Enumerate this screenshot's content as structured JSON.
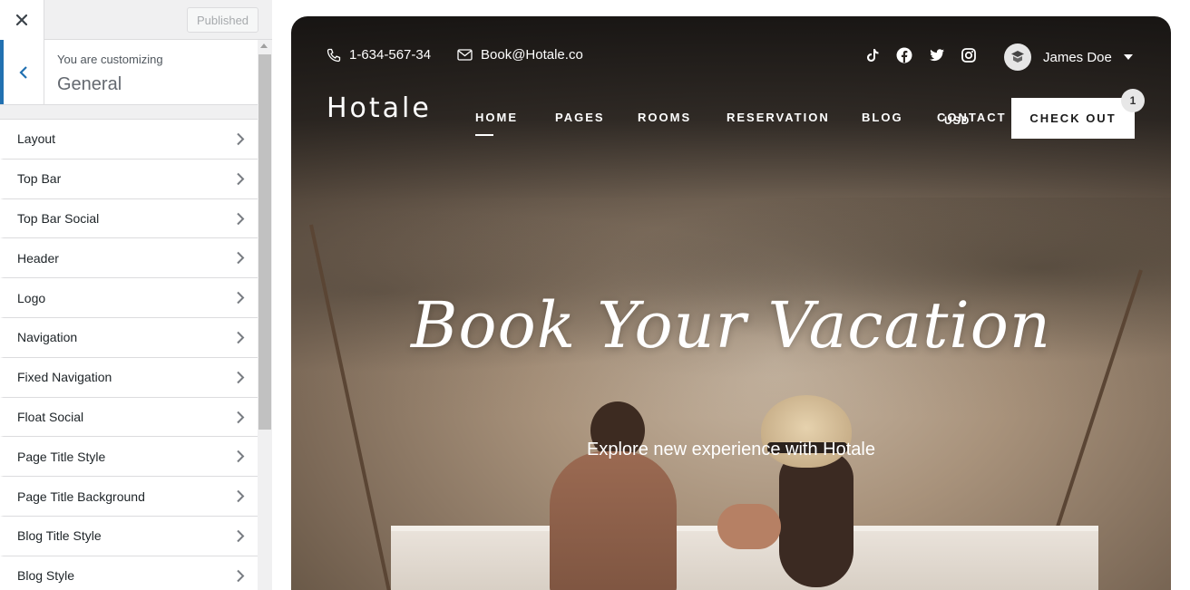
{
  "sidebar": {
    "published_label": "Published",
    "customizing_label": "You are customizing",
    "section_title": "General",
    "items": [
      {
        "label": "Layout"
      },
      {
        "label": "Top Bar"
      },
      {
        "label": "Top Bar Social"
      },
      {
        "label": "Header"
      },
      {
        "label": "Logo"
      },
      {
        "label": "Navigation"
      },
      {
        "label": "Fixed Navigation"
      },
      {
        "label": "Float Social"
      },
      {
        "label": "Page Title Style"
      },
      {
        "label": "Page Title Background"
      },
      {
        "label": "Blog Title Style"
      },
      {
        "label": "Blog Style"
      }
    ]
  },
  "preview": {
    "phone": "1-634-567-34",
    "email": "Book@Hotale.co",
    "social_icons": [
      "tiktok-icon",
      "facebook-icon",
      "twitter-icon",
      "instagram-icon"
    ],
    "user_name": "James Doe",
    "logo": "Hotale",
    "nav": [
      "HOME",
      "PAGES",
      "ROOMS",
      "RESERVATION",
      "BLOG",
      "CONTACT"
    ],
    "currency": "USD",
    "checkout_label": "CHECK OUT",
    "cart_count": "1",
    "hero_title": "Book Your Vacation",
    "hero_subtitle": "Explore new experience with Hotale"
  },
  "colors": {
    "accent": "#2271b1",
    "sidebar_bg": "#f0f0f1"
  }
}
